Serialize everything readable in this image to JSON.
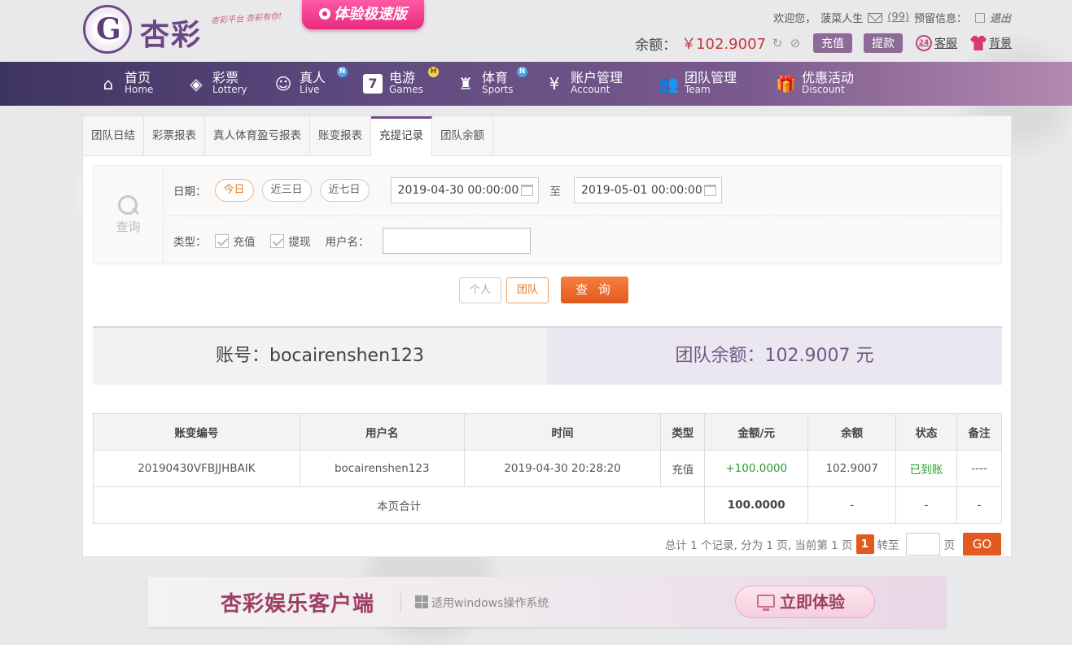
{
  "brand": {
    "logo_glyph": "G",
    "name": "杏彩",
    "slogan": "杏彩平台 杏彩有你!",
    "fast_badge": "体验极速版"
  },
  "header": {
    "welcome": "欢迎您，",
    "username": "菠菜人生",
    "mail_count": "(99)",
    "notice_label": "预留信息：",
    "logout": "退出",
    "balance_label": "余额：",
    "balance_value": "￥102.9007",
    "recharge": "充值",
    "withdraw": "提款",
    "service": "客服",
    "service_icon_text": "24",
    "theme": "背景"
  },
  "nav": [
    {
      "cn": "首页",
      "en": "Home",
      "icon": "home-icon"
    },
    {
      "cn": "彩票",
      "en": "Lottery",
      "icon": "lottery-icon"
    },
    {
      "cn": "真人",
      "en": "Live",
      "icon": "live-icon",
      "badge": "N"
    },
    {
      "cn": "电游",
      "en": "Games",
      "icon": "games-icon",
      "badge": "H"
    },
    {
      "cn": "体育",
      "en": "Sports",
      "icon": "sports-icon",
      "badge": "N"
    },
    {
      "cn": "账户管理",
      "en": "Account",
      "icon": "account-icon"
    },
    {
      "cn": "团队管理",
      "en": "Team",
      "icon": "team-icon"
    },
    {
      "cn": "优惠活动",
      "en": "Discount",
      "icon": "gift-icon"
    }
  ],
  "tabs": [
    "团队日结",
    "彩票报表",
    "真人体育盈亏报表",
    "账变报表",
    "充提记录",
    "团队余额"
  ],
  "query": {
    "side_label": "查询",
    "date_label": "日期：",
    "quick": [
      "今日",
      "近三日",
      "近七日"
    ],
    "start": "2019-04-30 00:00:00",
    "to": "至",
    "end": "2019-05-01 00:00:00",
    "type_label": "类型：",
    "types": [
      "充值",
      "提现"
    ],
    "user_label": "用户名：",
    "user_value": "",
    "scope": [
      "个人",
      "团队"
    ],
    "submit": "查 询"
  },
  "summary": {
    "account": "账号：bocairenshen123",
    "team_balance": "团队余额：102.9007 元"
  },
  "table": {
    "headers": [
      "账变编号",
      "用户名",
      "时间",
      "类型",
      "金额/元",
      "余额",
      "状态",
      "备注"
    ],
    "rows": [
      {
        "id": "20190430VFBJJHBAIK",
        "user": "bocairenshen123",
        "time": "2019-04-30 20:28:20",
        "type": "充值",
        "amount": "+100.0000",
        "balance": "102.9007",
        "status": "已到账",
        "note": "----"
      }
    ],
    "footer": {
      "label": "本页合计",
      "amount": "100.0000",
      "balance": "-",
      "status": "-",
      "note": "-"
    }
  },
  "pager": {
    "summary": "总计 1 个记录, 分为 1 页, 当前第 1 页",
    "current": "1",
    "goto": "转至",
    "page_unit": "页",
    "go": "GO"
  },
  "banner": {
    "title": "杏彩娱乐客户端",
    "subtitle": "适用windows操作系统",
    "cta": "立即体验"
  },
  "colors": {
    "accent": "#e25a1f",
    "nav": "#604a80",
    "success": "#2c9a32",
    "brand": "#6a4684"
  }
}
